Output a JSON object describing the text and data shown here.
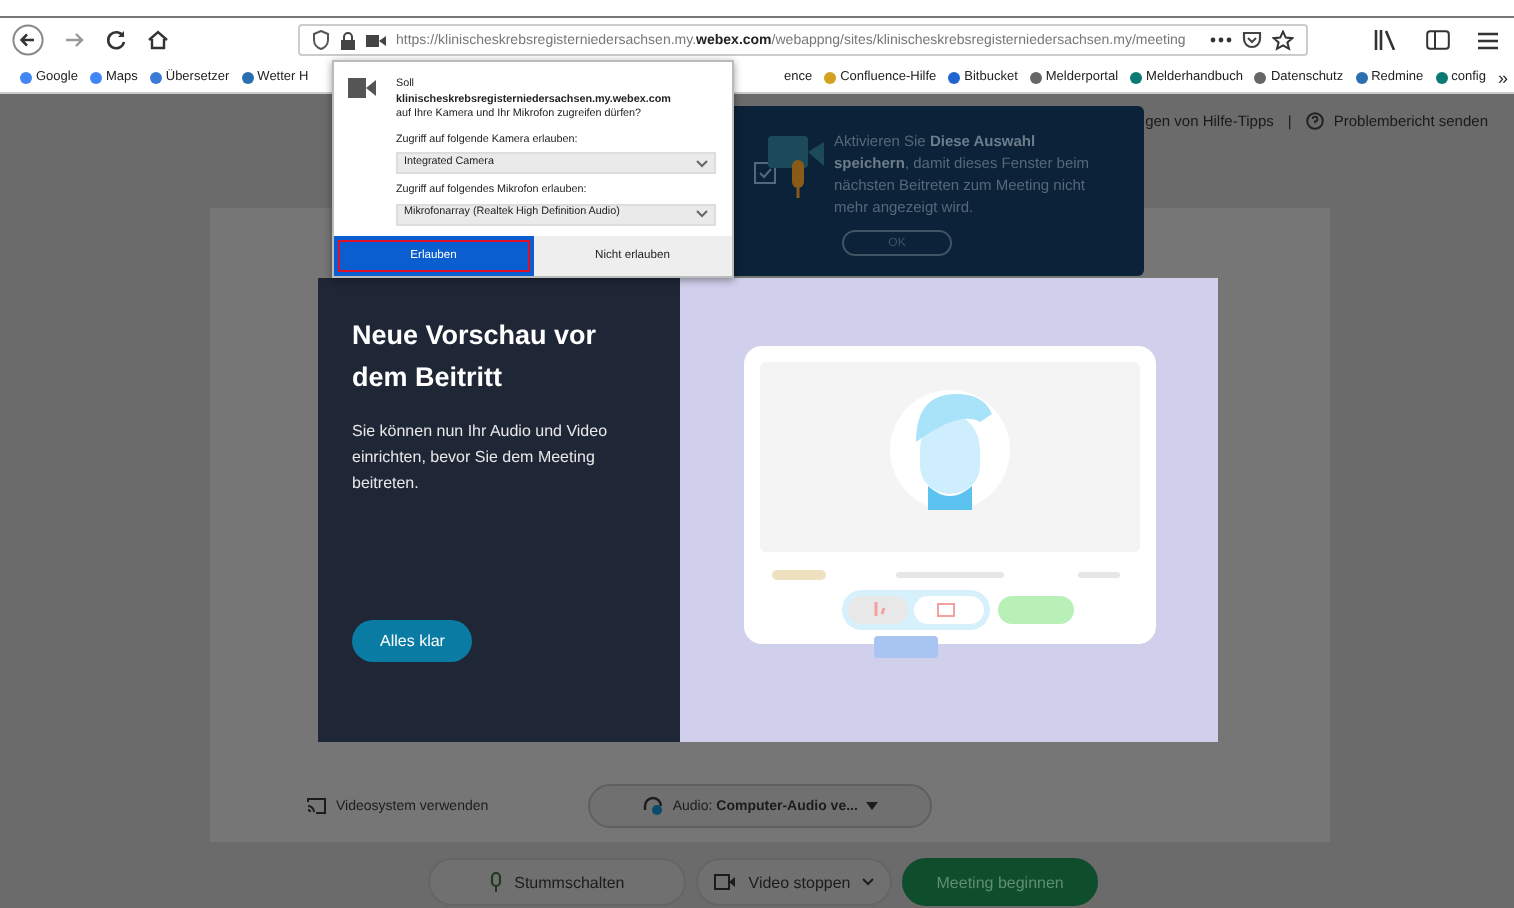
{
  "browser": {
    "url": "https://klinischeskrebsregisterniedersachsen.my.**webex.com**/webappng/sites/klinischeskrebsregisterniedersachsen.my/meeting",
    "bookmarks_left": [
      {
        "label": "Google",
        "kind": "google"
      },
      {
        "label": "Maps",
        "kind": "google"
      },
      {
        "label": "Übersetzer",
        "kind": "translate"
      },
      {
        "label": "Wetter H",
        "kind": "globe"
      }
    ],
    "bookmarks_right": [
      {
        "label": "ence",
        "kind": "none"
      },
      {
        "label": "Confluence-Hilfe",
        "kind": "confluence"
      },
      {
        "label": "Bitbucket",
        "kind": "bitbucket"
      },
      {
        "label": "Melderportal",
        "kind": "folder"
      },
      {
        "label": "Melderhandbuch",
        "kind": "sharepoint"
      },
      {
        "label": "Datenschutz",
        "kind": "folder"
      },
      {
        "label": "Redmine",
        "kind": "globe"
      },
      {
        "label": "config",
        "kind": "sharepoint"
      }
    ],
    "more": "»"
  },
  "permission": {
    "lead": "Soll",
    "site": "klinischeskrebsregisterniedersachsen.my.webex.com",
    "tail": "auf Ihre Kamera und Ihr Mikrofon zugreifen dürfen?",
    "camera_label": "Zugriff auf folgende Kamera erlauben:",
    "camera": "Integrated Camera",
    "mic_label": "Zugriff auf folgendes Mikrofon erlauben:",
    "mic": "Mikrofonarray (Realtek High Definition Audio)",
    "buttons": [
      {
        "label": "Erlauben",
        "selected": true
      },
      {
        "label": "Nicht erlauben",
        "selected": false
      }
    ]
  },
  "header": {
    "tips": "gen von Hilfe-Tipps",
    "separator": "|",
    "report": "Problembericht senden"
  },
  "tooltip": {
    "text": "Aktivieren Sie **Diese Auswahl speichern**, damit dieses Fenster beim nächsten Beitreten zum Meeting nicht mehr angezeigt wird.",
    "button": "OK"
  },
  "modal": {
    "title": "Neue Vorschau vor dem Beitritt",
    "body": "Sie können nun Ihr Audio und Video einrichten, bevor Sie dem Meeting beitreten.",
    "button": "Alles klar"
  },
  "bottom": {
    "video_system": "Videosystem verwenden",
    "audio": "Audio: **Computer-Audio ve...**"
  },
  "controls": [
    {
      "label": "Stummschalten",
      "kind": "mute"
    },
    {
      "label": "Video stoppen",
      "kind": "video"
    },
    {
      "label": "Meeting beginnen",
      "kind": "start"
    }
  ]
}
